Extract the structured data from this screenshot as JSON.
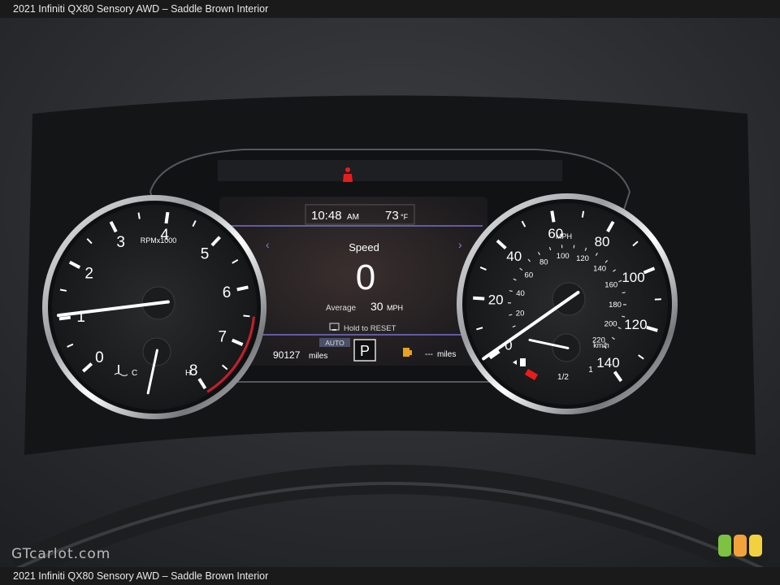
{
  "page": {
    "caption_top": "2021 Infiniti QX80 Sensory AWD – Saddle Brown Interior",
    "caption_bottom": "2021 Infiniti QX80 Sensory AWD – Saddle Brown Interior",
    "watermark": "GTcarlot.com",
    "logo_colors": [
      "#7ec242",
      "#f2a23a",
      "#f3d03e"
    ]
  },
  "tachometer": {
    "labels": [
      "0",
      "1",
      "2",
      "3",
      "4",
      "5",
      "6",
      "7",
      "8"
    ],
    "unit": "RPMx1000",
    "needle_rpm": 1.0,
    "temp_labels": {
      "cold": "C",
      "hot": "H"
    },
    "temp_level": 0.05
  },
  "speedometer": {
    "mph_labels": [
      "0",
      "20",
      "40",
      "60",
      "80",
      "100",
      "120",
      "140"
    ],
    "mph_unit": "MPH",
    "kmh_labels": [
      "20",
      "40",
      "60",
      "80",
      "100",
      "120",
      "140",
      "160",
      "180",
      "200",
      "220"
    ],
    "kmh_unit": "km/h",
    "needle_mph": 0,
    "fuel_labels": {
      "half": "1/2",
      "full": "1"
    },
    "fuel_level": 0.2
  },
  "display": {
    "time": "10:48",
    "ampm": "AM",
    "temperature": "73",
    "temp_unit": "°F",
    "title": "Speed",
    "speed_value": "0",
    "average_label": "Average",
    "average_value": "30",
    "average_unit": "MPH",
    "reset_hint": "Hold to RESET",
    "auto_label": "AUTO",
    "gear": "P",
    "odometer": "90127",
    "odometer_unit": "miles",
    "range_value": "---",
    "range_unit": "miles"
  },
  "colors": {
    "warning_red": "#e81c1c",
    "fuel_amber": "#e8a21e",
    "accent_purple": "#8a7fd8",
    "redline": "#c81e2a"
  }
}
